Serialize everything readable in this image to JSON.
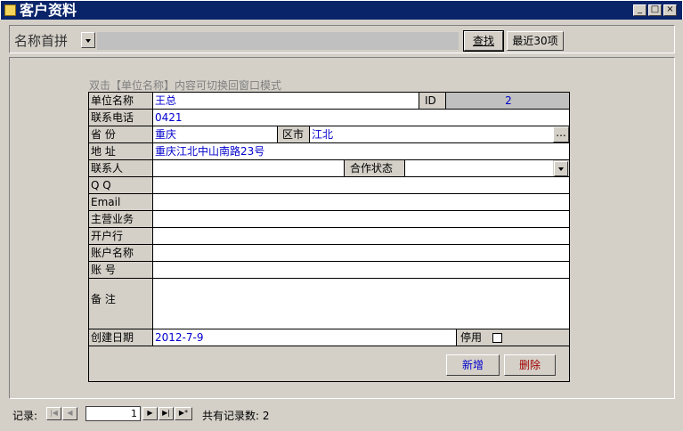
{
  "window": {
    "title": "客户资料",
    "controls": {
      "minimize": "_",
      "maximize": "□",
      "close": "×"
    }
  },
  "search": {
    "label": "名称首拼",
    "find_button": "查找",
    "recent_button": "最近30项",
    "value": ""
  },
  "hint": "双击【单位名称】内容可切换回窗口模式",
  "form": {
    "company_label": "单位名称",
    "company_value": "王总",
    "id_label": "ID",
    "id_value": "2",
    "phone_label": "联系电话",
    "phone_value": "0421",
    "province_label": "省 份",
    "province_value": "重庆",
    "district_label": "区市",
    "district_value": "江北",
    "ellipsis": "...",
    "address_label": "地 址",
    "address_value": "重庆江北中山南路23号",
    "contact_label": "联系人",
    "contact_value": "",
    "status_label": "合作状态",
    "status_value": "",
    "qq_label": "Q Q",
    "qq_value": "",
    "email_label": "Email",
    "email_value": "",
    "business_label": "主营业务",
    "business_value": "",
    "bank_label": "开户行",
    "bank_value": "",
    "account_name_label": "账户名称",
    "account_name_value": "",
    "account_no_label": "账 号",
    "account_no_value": "",
    "notes_label": "备 注",
    "notes_value": "",
    "created_label": "创建日期",
    "created_value": "2012-7-9",
    "disabled_label": "停用",
    "disabled_checked": false
  },
  "actions": {
    "new_button": "新增",
    "delete_button": "删除"
  },
  "navigation": {
    "records_label": "记录:",
    "first": "|◀",
    "prev": "◀",
    "next": "▶",
    "last": "▶|",
    "new": "▶*",
    "current_record": "1",
    "total_text": "共有记录数: 2"
  }
}
